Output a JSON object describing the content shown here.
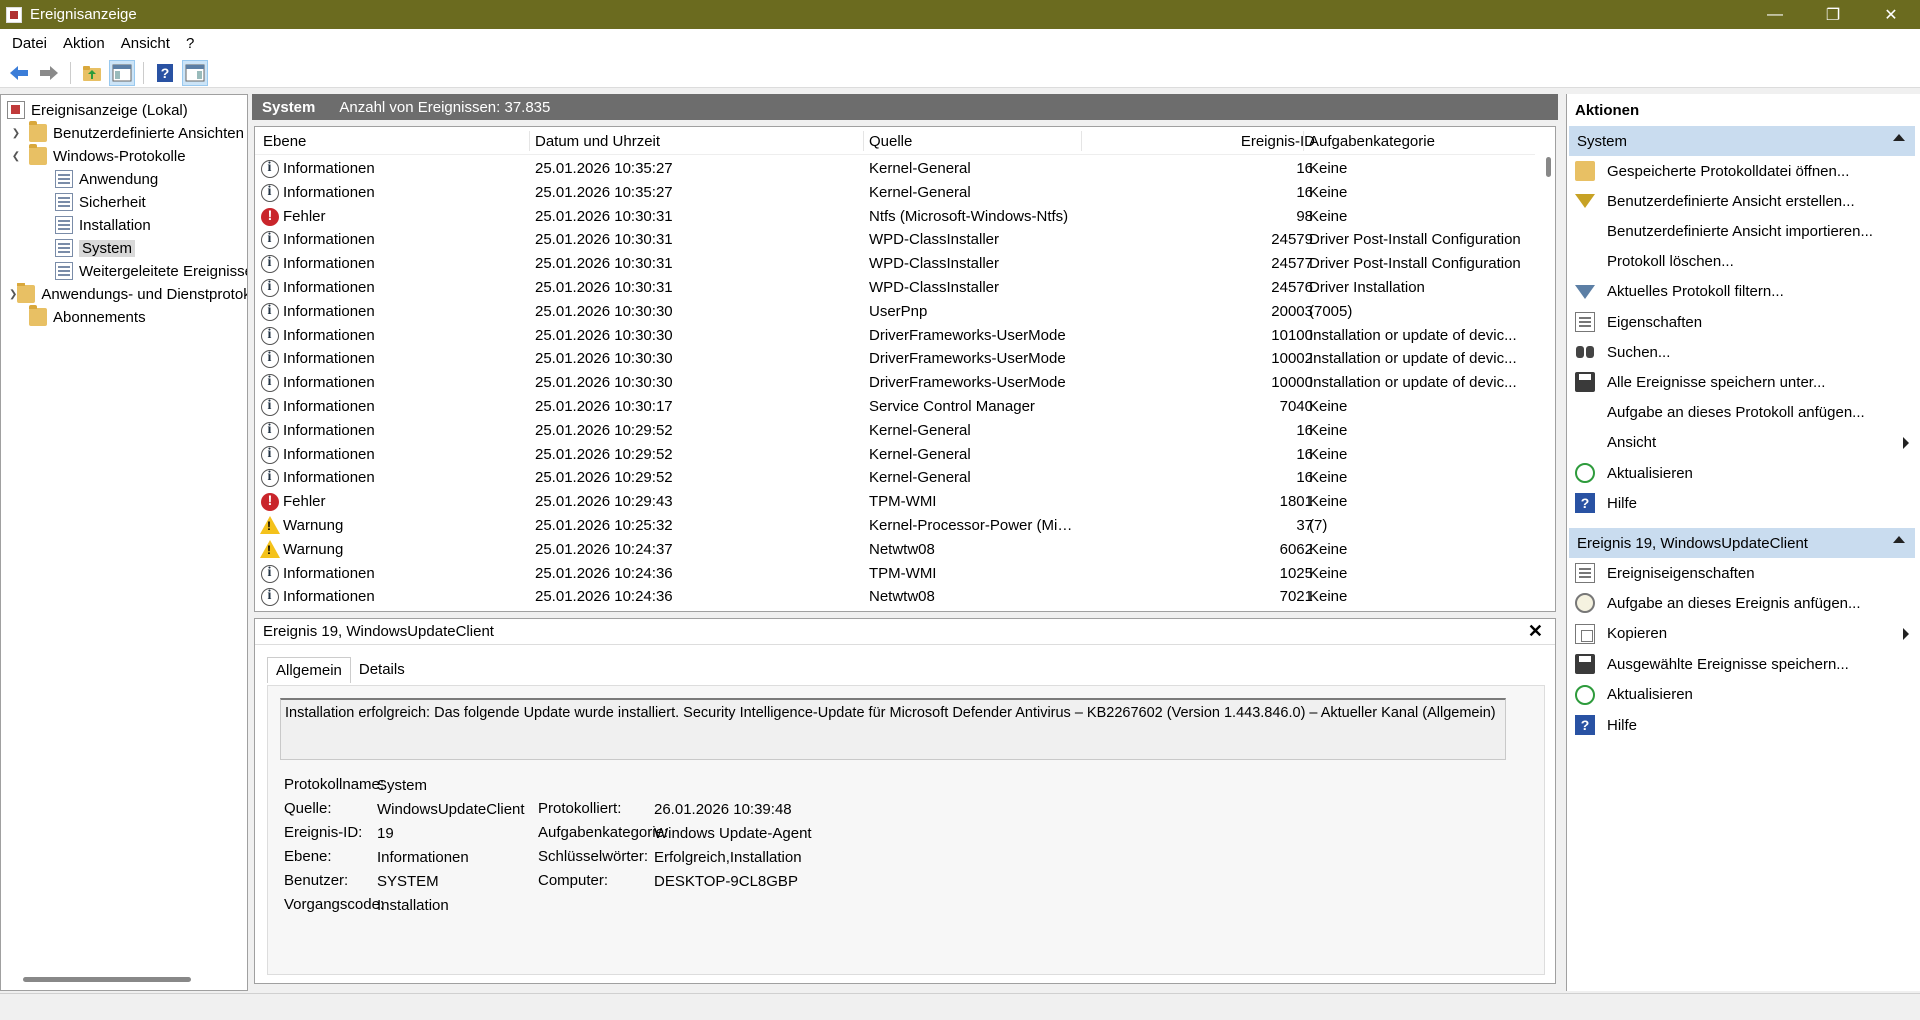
{
  "window": {
    "title": "Ereignisanzeige"
  },
  "menu": [
    {
      "label": "Datei"
    },
    {
      "label": "Aktion"
    },
    {
      "label": "Ansicht"
    },
    {
      "label": "?"
    }
  ],
  "tree": {
    "root": "Ereignisanzeige (Lokal)",
    "items": [
      {
        "label": "Benutzerdefinierte Ansichten"
      },
      {
        "label": "Windows-Protokolle"
      },
      {
        "label": "Anwendung"
      },
      {
        "label": "Sicherheit"
      },
      {
        "label": "Installation"
      },
      {
        "label": "System"
      },
      {
        "label": "Weitergeleitete Ereignisse"
      },
      {
        "label": "Anwendungs- und Dienstprotokolle"
      },
      {
        "label": "Abonnements"
      }
    ]
  },
  "list": {
    "title": "System",
    "count_text": "Anzahl von Ereignissen: 37.835",
    "columns": [
      "Ebene",
      "Datum und Uhrzeit",
      "Quelle",
      "Ereignis-ID",
      "Aufgabenkategorie"
    ],
    "rows": [
      {
        "level": "Informationen",
        "icon": "info-icon",
        "date": "25.01.2026 10:35:27",
        "source": "Kernel-General",
        "id": "16",
        "category": "Keine"
      },
      {
        "level": "Informationen",
        "icon": "info-icon",
        "date": "25.01.2026 10:35:27",
        "source": "Kernel-General",
        "id": "16",
        "category": "Keine"
      },
      {
        "level": "Fehler",
        "icon": "error-icon",
        "date": "25.01.2026 10:30:31",
        "source": "Ntfs (Microsoft-Windows-Ntfs)",
        "id": "98",
        "category": "Keine"
      },
      {
        "level": "Informationen",
        "icon": "info-icon",
        "date": "25.01.2026 10:30:31",
        "source": "WPD-ClassInstaller",
        "id": "24579",
        "category": "Driver Post-Install Configuration"
      },
      {
        "level": "Informationen",
        "icon": "info-icon",
        "date": "25.01.2026 10:30:31",
        "source": "WPD-ClassInstaller",
        "id": "24577",
        "category": "Driver Post-Install Configuration"
      },
      {
        "level": "Informationen",
        "icon": "info-icon",
        "date": "25.01.2026 10:30:31",
        "source": "WPD-ClassInstaller",
        "id": "24576",
        "category": "Driver Installation"
      },
      {
        "level": "Informationen",
        "icon": "info-icon",
        "date": "25.01.2026 10:30:30",
        "source": "UserPnp",
        "id": "20003",
        "category": "(7005)"
      },
      {
        "level": "Informationen",
        "icon": "info-icon",
        "date": "25.01.2026 10:30:30",
        "source": "DriverFrameworks-UserMode",
        "id": "10100",
        "category": "Installation or update of devic..."
      },
      {
        "level": "Informationen",
        "icon": "info-icon",
        "date": "25.01.2026 10:30:30",
        "source": "DriverFrameworks-UserMode",
        "id": "10002",
        "category": "Installation or update of devic..."
      },
      {
        "level": "Informationen",
        "icon": "info-icon",
        "date": "25.01.2026 10:30:30",
        "source": "DriverFrameworks-UserMode",
        "id": "10000",
        "category": "Installation or update of devic..."
      },
      {
        "level": "Informationen",
        "icon": "info-icon",
        "date": "25.01.2026 10:30:17",
        "source": "Service Control Manager",
        "id": "7040",
        "category": "Keine"
      },
      {
        "level": "Informationen",
        "icon": "info-icon",
        "date": "25.01.2026 10:29:52",
        "source": "Kernel-General",
        "id": "16",
        "category": "Keine"
      },
      {
        "level": "Informationen",
        "icon": "info-icon",
        "date": "25.01.2026 10:29:52",
        "source": "Kernel-General",
        "id": "16",
        "category": "Keine"
      },
      {
        "level": "Informationen",
        "icon": "info-icon",
        "date": "25.01.2026 10:29:52",
        "source": "Kernel-General",
        "id": "16",
        "category": "Keine"
      },
      {
        "level": "Fehler",
        "icon": "error-icon",
        "date": "25.01.2026 10:29:43",
        "source": "TPM-WMI",
        "id": "1801",
        "category": "Keine"
      },
      {
        "level": "Warnung",
        "icon": "warning-icon",
        "date": "25.01.2026 10:25:32",
        "source": "Kernel-Processor-Power (Micr...",
        "id": "37",
        "category": "(7)"
      },
      {
        "level": "Warnung",
        "icon": "warning-icon",
        "date": "25.01.2026 10:24:37",
        "source": "Netwtw08",
        "id": "6062",
        "category": "Keine"
      },
      {
        "level": "Informationen",
        "icon": "info-icon",
        "date": "25.01.2026 10:24:36",
        "source": "TPM-WMI",
        "id": "1025",
        "category": "Keine"
      },
      {
        "level": "Informationen",
        "icon": "info-icon",
        "date": "25.01.2026 10:24:36",
        "source": "Netwtw08",
        "id": "7021",
        "category": "Keine"
      }
    ]
  },
  "detail": {
    "title": "Ereignis 19, WindowsUpdateClient",
    "tabs": [
      "Allgemein",
      "Details"
    ],
    "description": "Installation erfolgreich: Das folgende Update wurde installiert. Security Intelligence-Update für Microsoft Defender Antivirus – KB2267602 (Version 1.443.846.0) – Aktueller Kanal (Allgemein)",
    "fields": {
      "log_name_label": "Protokollname:",
      "log_name": "System",
      "source_label": "Quelle:",
      "source": "WindowsUpdateClient",
      "logged_label": "Protokolliert:",
      "logged": "26.01.2026 10:39:48",
      "event_id_label": "Ereignis-ID:",
      "event_id": "19",
      "task_category_label": "Aufgabenkategorie:",
      "task_category": "Windows Update-Agent",
      "level_label": "Ebene:",
      "level": "Informationen",
      "keywords_label": "Schlüsselwörter:",
      "keywords": "Erfolgreich,Installation",
      "user_label": "Benutzer:",
      "user": "SYSTEM",
      "computer_label": "Computer:",
      "computer": "DESKTOP-9CL8GBP",
      "opcode_label": "Vorgangscode:",
      "opcode": "Installation"
    }
  },
  "actions": {
    "title": "Aktionen",
    "system_section": {
      "title": "System",
      "items": [
        {
          "label": "Gespeicherte Protokolldatei öffnen...",
          "icon": "open-folder-icon"
        },
        {
          "label": "Benutzerdefinierte Ansicht erstellen...",
          "icon": "filter-icon"
        },
        {
          "label": "Benutzerdefinierte Ansicht importieren...",
          "icon": ""
        },
        {
          "label": "Protokoll löschen...",
          "icon": ""
        },
        {
          "label": "Aktuelles Protokoll filtern...",
          "icon": "filter-icon"
        },
        {
          "label": "Eigenschaften",
          "icon": "properties-icon"
        },
        {
          "label": "Suchen...",
          "icon": "binoculars-icon"
        },
        {
          "label": "Alle Ereignisse speichern unter...",
          "icon": "save-icon"
        },
        {
          "label": "Aufgabe an dieses Protokoll anfügen...",
          "icon": ""
        },
        {
          "label": "Ansicht",
          "icon": ""
        },
        {
          "label": "Aktualisieren",
          "icon": "refresh-icon"
        },
        {
          "label": "Hilfe",
          "icon": "help-icon"
        }
      ]
    },
    "event_section": {
      "title": "Ereignis 19, WindowsUpdateClient",
      "items": [
        {
          "label": "Ereigniseigenschaften",
          "icon": "properties-icon"
        },
        {
          "label": "Aufgabe an dieses Ereignis anfügen...",
          "icon": "clock-icon"
        },
        {
          "label": "Kopieren",
          "icon": "copy-icon"
        },
        {
          "label": "Ausgewählte Ereignisse speichern...",
          "icon": "save-icon"
        },
        {
          "label": "Aktualisieren",
          "icon": "refresh-icon"
        },
        {
          "label": "Hilfe",
          "icon": "help-icon"
        }
      ]
    }
  }
}
